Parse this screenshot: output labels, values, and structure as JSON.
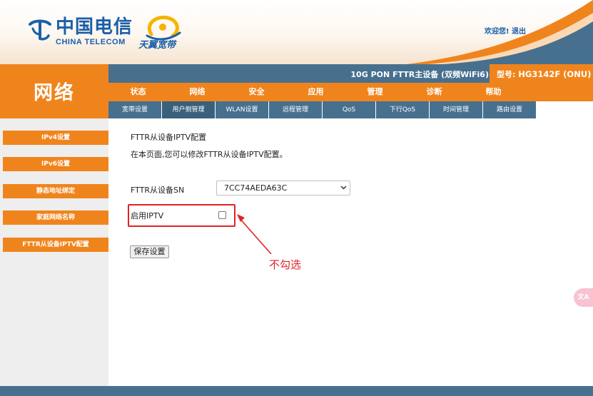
{
  "header": {
    "logo_cn": "中国电信",
    "logo_en": "CHINA TELECOM",
    "brand2": "天翼宽带",
    "user_welcome": "欢迎您!",
    "logout": "退出"
  },
  "section_title": "网络",
  "infobar": {
    "device_name": "10G PON FTTR主设备 (双频WiFi6)",
    "model_label": "型号:",
    "model_value": "HG3142F (ONU)"
  },
  "main_nav": [
    "状态",
    "网络",
    "安全",
    "应用",
    "管理",
    "诊断",
    "帮助"
  ],
  "sub_nav": [
    "宽带设置",
    "用户侧管理",
    "WLAN设置",
    "远程管理",
    "QoS",
    "下行QoS",
    "时间管理",
    "路由设置"
  ],
  "sidebar": [
    "IPv4设置",
    "IPv6设置",
    "静态地址绑定",
    "家庭网络名称",
    "FTTR从设备IPTV配置"
  ],
  "content": {
    "title": "FTTR从设备IPTV配置",
    "description": "在本页面,您可以修改FTTR从设备IPTV配置。",
    "sn_label": "FTTR从设备SN",
    "sn_value": "7CC74AEDA63C",
    "iptv_label": "启用IPTV",
    "iptv_enabled": false,
    "save_label": "保存设置",
    "annotation": "不勾选"
  },
  "colors": {
    "orange": "#f0841c",
    "steel_blue": "#47708f",
    "annotation_red": "#e02424"
  },
  "icons": {
    "select_chevron": "chevron-down-icon",
    "translate": "translate-icon"
  }
}
